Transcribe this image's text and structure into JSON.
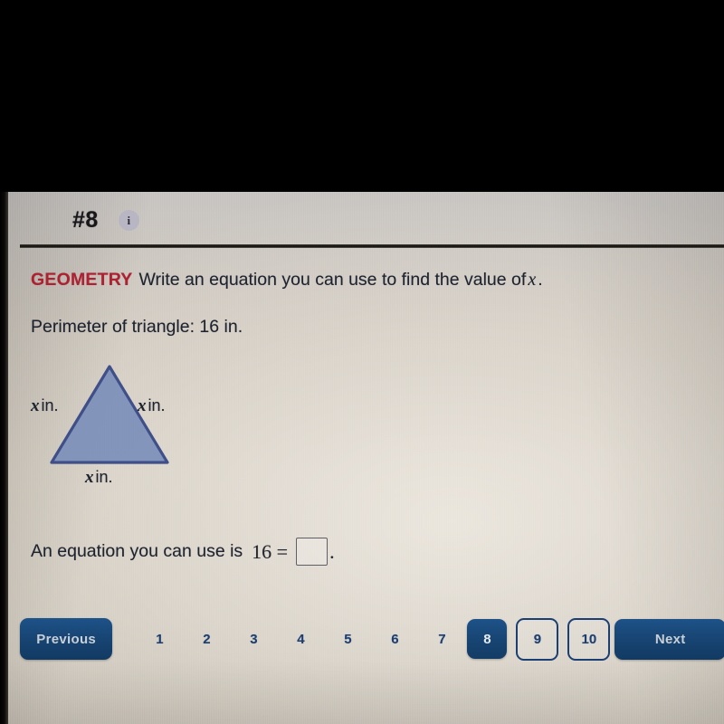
{
  "header": {
    "question_number": "#8",
    "info_icon": "info-icon"
  },
  "prompt": {
    "subject_label": "GEOMETRY",
    "text_before_var": "Write an equation you can use to find the value of",
    "variable": "x",
    "text_after_var": "."
  },
  "perimeter": {
    "text": "Perimeter of triangle: 16 in."
  },
  "figure": {
    "type": "triangle",
    "fill_color": "#8193bb",
    "stroke_color": "#3a4a86",
    "label_left_var": "x",
    "label_left_unit": "in.",
    "label_right_var": "x",
    "label_right_unit": "in.",
    "label_base_var": "x",
    "label_base_unit": "in."
  },
  "answer": {
    "lead_text": "An equation you can use is",
    "equation": "16 =",
    "input_value": "",
    "trailing_punctuation": "."
  },
  "pager": {
    "previous_label": "Previous",
    "next_label": "Next",
    "pages": [
      "1",
      "2",
      "3",
      "4",
      "5",
      "6",
      "7"
    ],
    "current_page": "8",
    "boxed_pages": [
      "9",
      "10"
    ]
  },
  "colors": {
    "accent_navy": "#1b4b82",
    "subject_red": "#b02030",
    "text_dark": "#1d2330",
    "page_background": "#d0c9bf"
  }
}
